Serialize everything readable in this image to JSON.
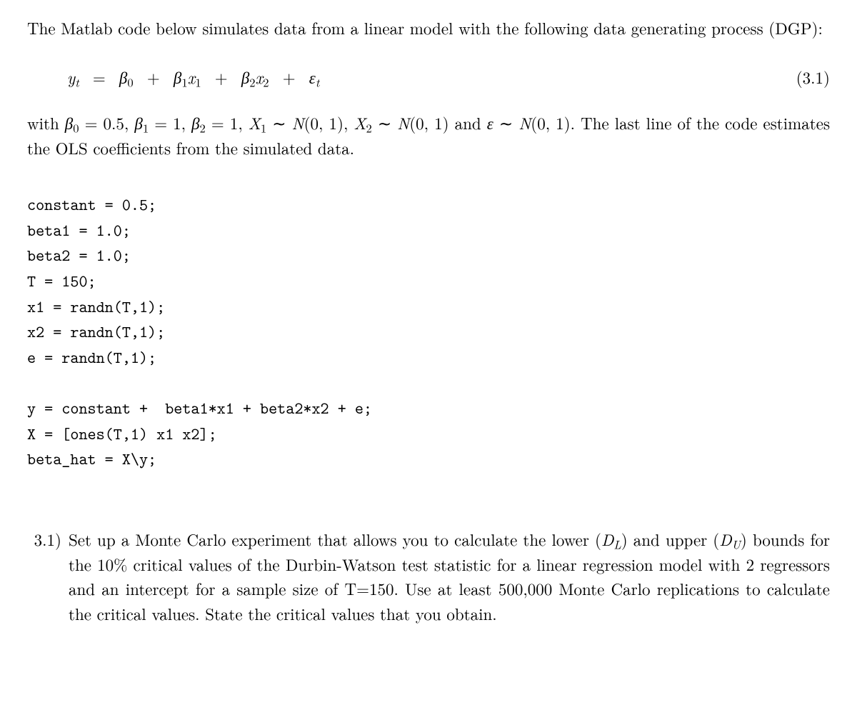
{
  "intro": "The Matlab code below simulates data from a linear model with the following data generating process (DGP):",
  "equation": {
    "lhs_var": "y",
    "lhs_sub": "t",
    "b0": "β",
    "b0_sub": "0",
    "b1": "β",
    "b1_sub": "1",
    "x1": "x",
    "x1_sub": "1",
    "b2": "β",
    "b2_sub": "2",
    "x2": "x",
    "x2_sub": "2",
    "eps": "ε",
    "eps_sub": "t",
    "number": "(3.1)"
  },
  "after_eq": {
    "lead": "with ",
    "b0": "β",
    "b0_sub": "0",
    "b0_eq": " = 0.5, ",
    "b1": "β",
    "b1_sub": "1",
    "b1_eq": " = 1, ",
    "b2": "β",
    "b2_sub": "2",
    "b2_eq": " = 1, ",
    "X1": "X",
    "X1_sub": "1",
    "X1_dist": " ∼ ",
    "N": "N",
    "N01": "(0, 1), ",
    "X2": "X",
    "X2_sub": "2",
    "X2_dist": " ∼ ",
    "N2": "N",
    "N01b": "(0, 1) and ",
    "eps": "ε",
    "eps_dist": " ∼ ",
    "N3": "N",
    "N01c": "(0, 1). ",
    "tail": "The last line of the code estimates the OLS coefficients from the simulated data."
  },
  "code": {
    "l1": "constant = 0.5;",
    "l2": "beta1 = 1.0;",
    "l3": "beta2 = 1.0;",
    "l4": "T = 150;",
    "l5": "x1 = randn(T,1);",
    "l6": "x2 = randn(T,1);",
    "l7": "e = randn(T,1);",
    "l8": "",
    "l9": "y = constant +  beta1*x1 + beta2*x2 + e;",
    "l10": "X = [ones(T,1) x1 x2];",
    "l11": "beta_hat = X\\y;"
  },
  "question": {
    "label": "3.1)",
    "body_pre": "Set up a Monte Carlo experiment that allows you to calculate the lower (",
    "D": "D",
    "DL_sub": "L",
    "body_mid1": ") and upper (",
    "D2": "D",
    "DU_sub": "U",
    "body_mid2": ") bounds for the 10% critical values of the Durbin-Watson test statistic for a linear regression model with 2 regressors and an intercept for a sample size of T=150. Use at least 500,000 Monte Carlo replications to calculate the critical values. State the critical values that you obtain."
  }
}
